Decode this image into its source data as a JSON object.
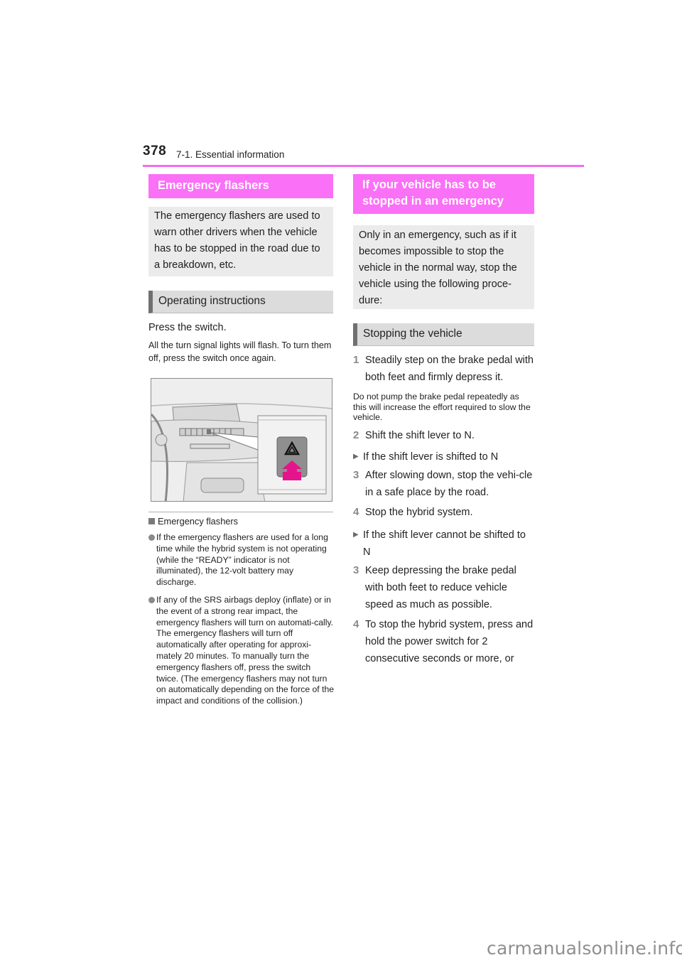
{
  "header": {
    "page_number": "378",
    "section": "7-1. Essential information"
  },
  "left": {
    "heading": "Emergency flashers",
    "intro": "The emergency flashers are used to warn other drivers when the vehicle has to be stopped in the road due to a breakdown, etc.",
    "subheading": "Operating instructions",
    "instruction": "Press the switch.",
    "instruction_note": "All the turn signal lights will flash. To turn them off, press the switch once again.",
    "figure": {
      "icon": "hazard-triangle-icon",
      "arrow": "press-arrow-icon",
      "arrow_color": "#e6148c"
    },
    "notes": {
      "heading": "Emergency flashers",
      "items": [
        "If the emergency flashers are used for a long time while the hybrid system is not operating (while the “READY” indicator is not illuminated), the 12-volt battery may discharge.",
        "If any of the SRS airbags deploy (inflate) or in the event of a strong rear impact, the emergency flashers will turn on automati-cally. The emergency flashers will turn off automatically after operating for approxi-mately 20 minutes. To manually turn the emergency flashers off, press the switch twice. (The emergency flashers may not turn on automatically depending on the force of the impact and conditions of the collision.)"
      ]
    }
  },
  "right": {
    "heading": "If your vehicle has to be stopped in an emergency",
    "intro": "Only in an emergency, such as if it becomes impossible to stop the vehicle in the normal way, stop the vehicle using the following proce-dure:",
    "subheading": "Stopping the vehicle",
    "step1": {
      "num": "1",
      "text": "Steadily step on the brake pedal with both feet and firmly depress it."
    },
    "step1_note": "Do not pump the brake pedal repeatedly as this will increase the effort required to slow the vehicle.",
    "step2": {
      "num": "2",
      "text": "Shift the shift lever to N."
    },
    "case_a": {
      "label": "If the shift lever is shifted to N",
      "steps": [
        {
          "num": "3",
          "text": "After slowing down, stop the vehi-cle in a safe place by the road."
        },
        {
          "num": "4",
          "text": "Stop the hybrid system."
        }
      ]
    },
    "case_b": {
      "label": "If the shift lever cannot be shifted to N",
      "steps": [
        {
          "num": "3",
          "text": "Keep depressing the brake pedal with both feet to reduce vehicle speed as much as possible."
        },
        {
          "num": "4",
          "text": "To stop the hybrid system, press and hold the power switch for 2 consecutive seconds or more, or"
        }
      ]
    }
  },
  "colors": {
    "accent": "#fa70f6",
    "rule": "#f26cf0",
    "grey_box": "#ebebeb",
    "sub_heading": "#dcdcdc"
  },
  "watermark": "carmanualsonline.info"
}
